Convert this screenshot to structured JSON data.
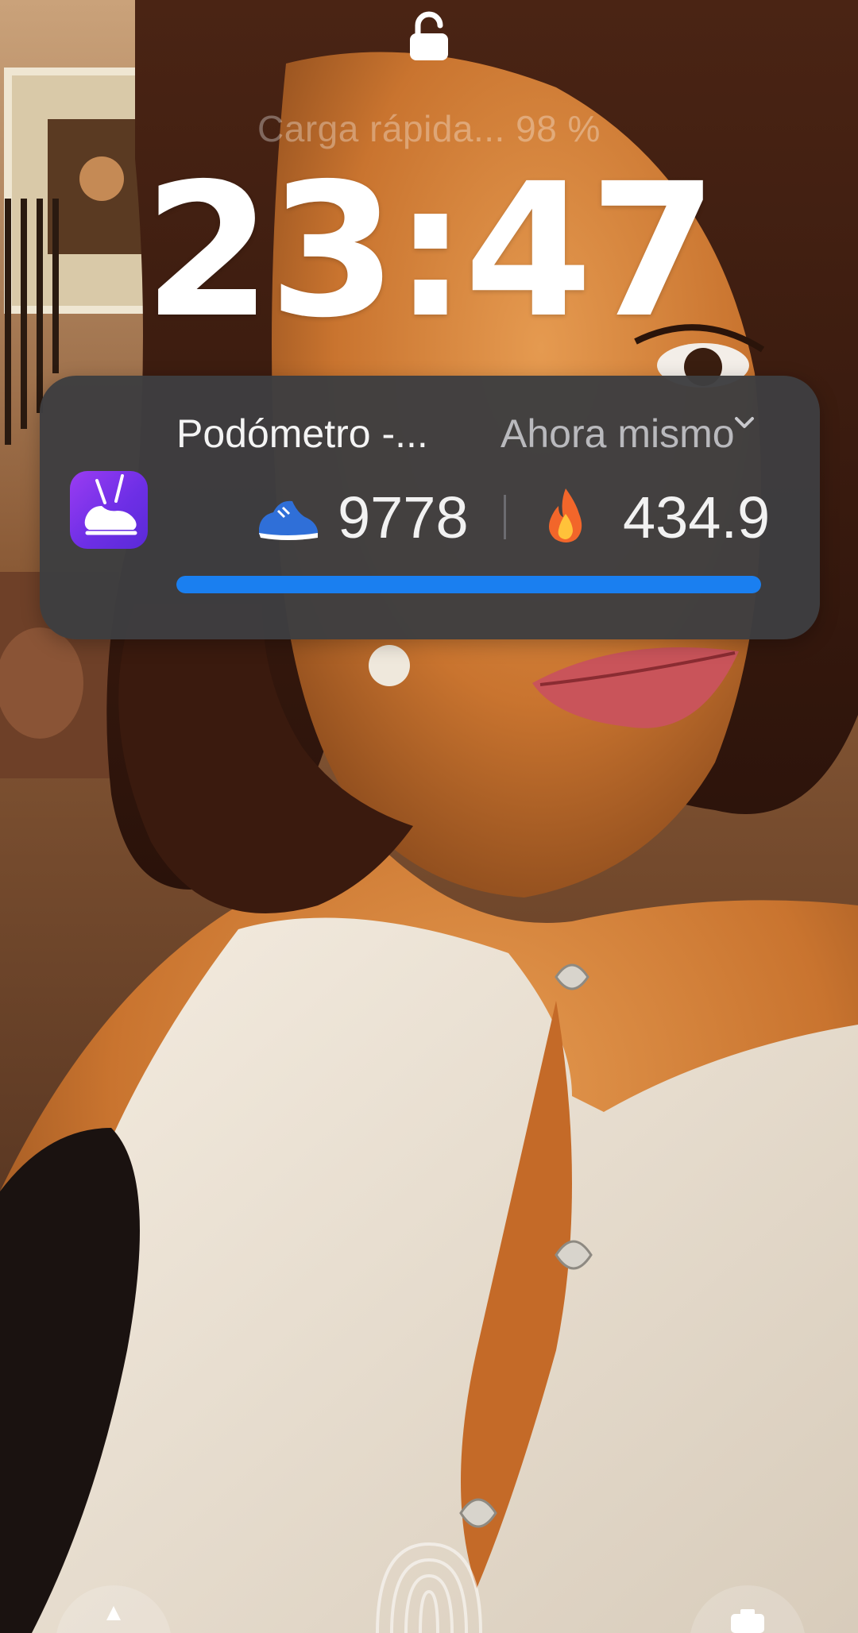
{
  "lockscreen": {
    "charging_text": "Carga rápida... 98 %",
    "time": "23:47"
  },
  "notification": {
    "app_name": "Podómetro -...",
    "timestamp": "Ahora mismo",
    "app_icon": "sneaker-icon",
    "steps": "9778",
    "calories": "434.9",
    "progress": 1.0,
    "accent_color": "#1a7ff0",
    "card_color": "#3e3e40",
    "app_icon_color": "#7a33ea"
  },
  "icons": {
    "lock": "lock-open-icon",
    "steps": "sneaker-icon",
    "calories": "flame-icon",
    "expand": "chevron-down-icon",
    "unlock": "fingerprint-icon",
    "shortcut_left": "flashlight-icon",
    "shortcut_right": "camera-icon"
  }
}
